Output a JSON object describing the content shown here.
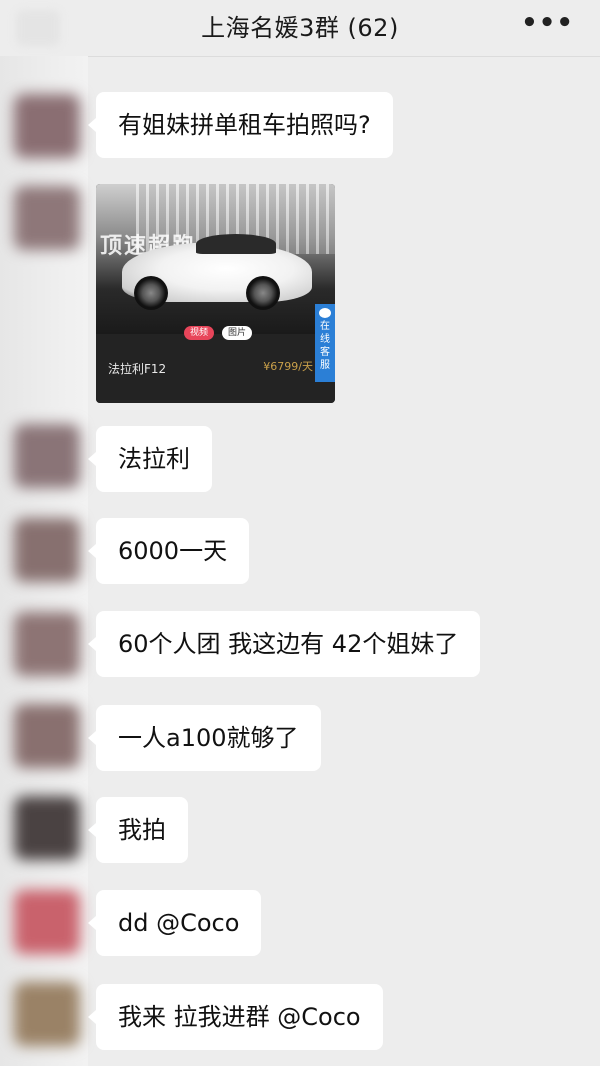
{
  "header": {
    "title": "上海名媛3群 (62)",
    "more_icon": "more-dots-icon",
    "more_glyph": "•••"
  },
  "messages": [
    {
      "type": "text",
      "text": "有姐妹拼单租车拍照吗?"
    },
    {
      "type": "image-card",
      "card": {
        "store_sign": "顶速超跑",
        "name": "法拉利F12",
        "price": "¥6799/天",
        "tag_left": "视频",
        "tag_right": "图片",
        "service": "在线客服"
      }
    },
    {
      "type": "text",
      "text": "法拉利"
    },
    {
      "type": "text",
      "text": "6000一天"
    },
    {
      "type": "text",
      "text": "60个人团 我这边有 42个姐妹了"
    },
    {
      "type": "text",
      "text": "一人a100就够了"
    },
    {
      "type": "text",
      "text": "我拍"
    },
    {
      "type": "text",
      "text": "dd @Coco"
    },
    {
      "type": "text",
      "text": "我来 拉我进群 @Coco"
    }
  ],
  "colors": {
    "background": "#ededed",
    "bubble": "#ffffff",
    "service_tab": "#2b7fd6",
    "price": "#c9a04a"
  }
}
